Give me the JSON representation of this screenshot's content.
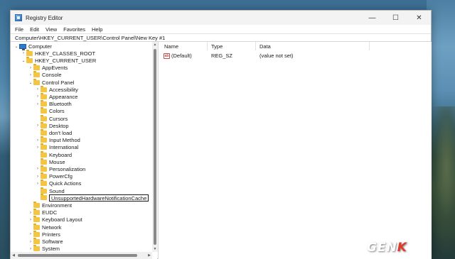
{
  "window": {
    "title": "Registry Editor"
  },
  "window_controls": {
    "minimize": "—",
    "maximize": "☐",
    "close": "✕"
  },
  "menu": [
    "File",
    "Edit",
    "View",
    "Favorites",
    "Help"
  ],
  "address": "Computer\\HKEY_CURRENT_USER\\Control Panel\\New Key #1",
  "tree": {
    "root": "Computer",
    "hives": {
      "classes_root": "HKEY_CLASSES_ROOT",
      "current_user": "HKEY_CURRENT_USER"
    },
    "current_user_children_top": [
      "AppEvents",
      "Console",
      "Control Panel"
    ],
    "control_panel_children": [
      "Accessibility",
      "Appearance",
      "Bluetooth",
      "Colors",
      "Cursors",
      "Desktop",
      "don't load",
      "Input Method",
      "International",
      "Keyboard",
      "Mouse",
      "Personalization",
      "PowerCfg",
      "Quick Actions",
      "Sound"
    ],
    "rename_value": "UnsupportedHardwareNotificationCache",
    "current_user_children_bottom": [
      "Environment",
      "EUDC",
      "Keyboard Layout",
      "Network",
      "Printers",
      "Software",
      "System"
    ]
  },
  "list": {
    "headers": {
      "name": "Name",
      "type": "Type",
      "data": "Data"
    },
    "rows": [
      {
        "name": "(Default)",
        "type": "REG_SZ",
        "data": "(value not set)"
      }
    ]
  },
  "watermark": {
    "part1": "GEN",
    "part2": "K"
  },
  "colors": {
    "folder": "#f4c542",
    "accent": "#2b7bd1",
    "watermark_accent": "#e03b2a"
  },
  "icons": {
    "folder": "folder-icon",
    "computer": "computer-icon",
    "string_value": "reg-string-icon"
  }
}
